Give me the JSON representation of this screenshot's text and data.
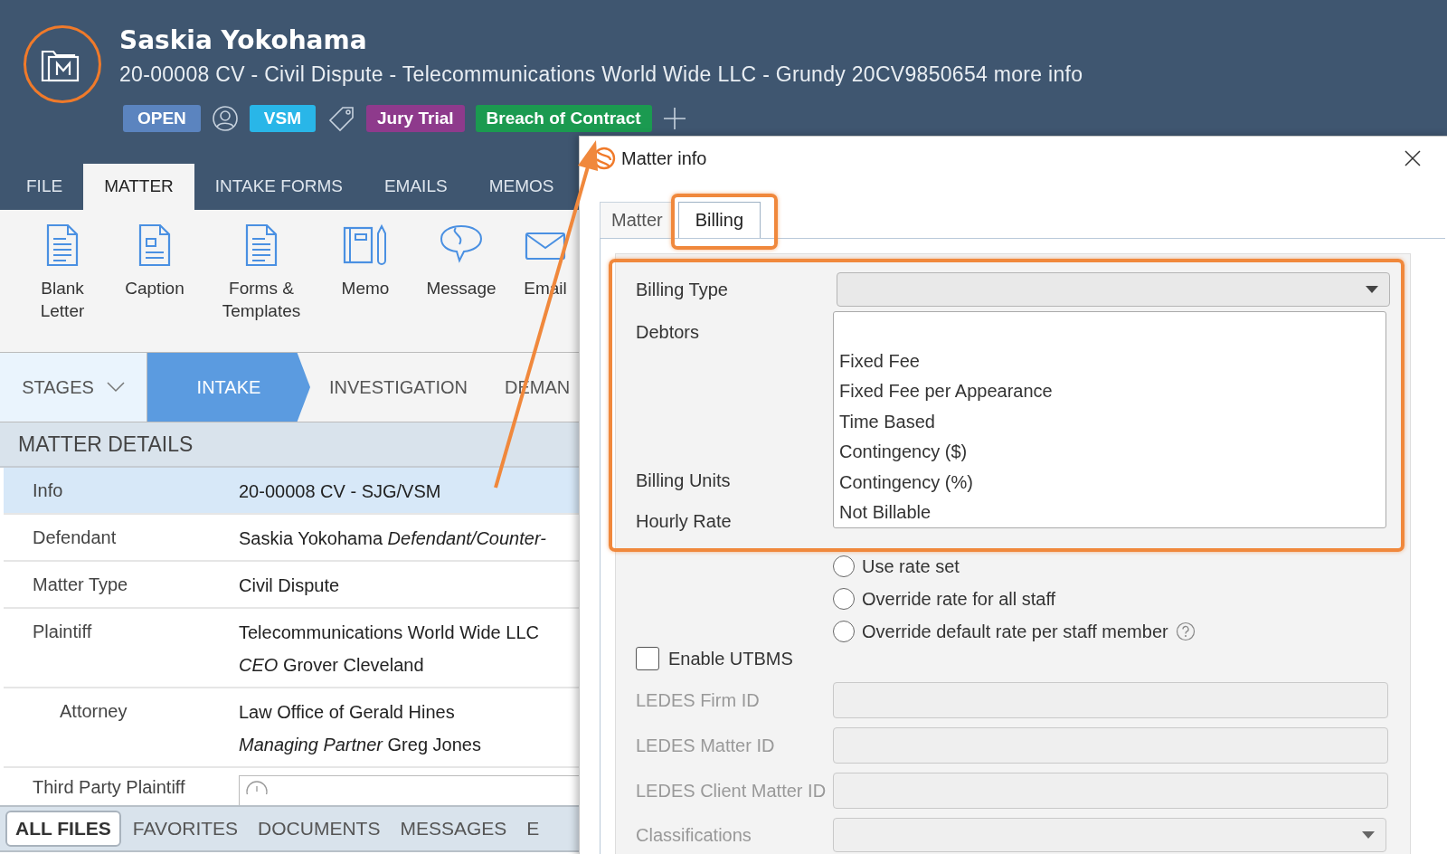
{
  "header": {
    "title": "Saskia Yokohama",
    "subtitle": "20-00008 CV - Civil Dispute - Telecommunications World Wide LLC - Grundy 20CV9850654 more info",
    "status": "OPEN",
    "assignee": "VSM",
    "tags": [
      {
        "label": "Jury Trial",
        "color": "#8e3a8c"
      },
      {
        "label": "Breach of Contract",
        "color": "#1b9a50"
      }
    ]
  },
  "ribbon_tabs": [
    {
      "label": "FILE",
      "selected": false
    },
    {
      "label": "MATTER",
      "selected": true
    },
    {
      "label": "INTAKE FORMS",
      "selected": false
    },
    {
      "label": "EMAILS",
      "selected": false
    },
    {
      "label": "MEMOS",
      "selected": false
    }
  ],
  "ribbon_actions": [
    {
      "label": "Blank Letter",
      "kind": "letter"
    },
    {
      "label": "Caption",
      "kind": "caption"
    },
    {
      "label": "Forms & Templates",
      "kind": "forms"
    },
    {
      "label": "Memo",
      "kind": "memo"
    },
    {
      "label": "Message",
      "kind": "message"
    },
    {
      "label": "Email",
      "kind": "email"
    }
  ],
  "stages": {
    "label": "STAGES",
    "steps": [
      {
        "label": "INTAKE",
        "selected": true
      },
      {
        "label": "INVESTIGATION",
        "selected": false
      },
      {
        "label": "DEMAN",
        "selected": false
      }
    ]
  },
  "matter_details": {
    "title": "MATTER DETAILS",
    "rows": [
      {
        "label": "Info",
        "lines": [
          "20-00008 CV - SJG/VSM"
        ],
        "selected": true
      },
      {
        "label": "Defendant",
        "lines": [
          "Saskia Yokohama *Defendant/Counter-*"
        ],
        "selected": false
      },
      {
        "label": "Matter Type",
        "lines": [
          "Civil Dispute"
        ],
        "selected": false
      },
      {
        "label": "Plaintiff",
        "lines": [
          "Telecommunications World Wide LLC",
          "*CEO* Grover Cleveland"
        ],
        "selected": false,
        "children": [
          {
            "label": "Attorney",
            "lines": [
              "Law Office of Gerald Hines",
              "*Managing Partner* Greg Jones"
            ],
            "selected": false
          }
        ]
      },
      {
        "label": "Third Party Plaintiff",
        "kind": "field",
        "selected": false
      }
    ]
  },
  "file_tabs": [
    {
      "label": "ALL FILES",
      "selected": true
    },
    {
      "label": "FAVORITES",
      "selected": false
    },
    {
      "label": "DOCUMENTS",
      "selected": false
    },
    {
      "label": "MESSAGES",
      "selected": false
    },
    {
      "label": "E",
      "selected": false
    }
  ],
  "dialog": {
    "title": "Matter info",
    "tabs": [
      {
        "label": "Matter",
        "selected": false
      },
      {
        "label": "Billing",
        "selected": true
      }
    ],
    "billing_type": {
      "label": "Billing Type",
      "expanded": true,
      "options": [
        "Fixed Fee",
        "Fixed Fee per Appearance",
        "Time Based",
        "Contingency ($)",
        "Contingency (%)",
        "Not Billable"
      ]
    },
    "debtors_label": "Debtors",
    "billing_units_label": "Billing Units",
    "hourly_rate": {
      "label": "Hourly Rate",
      "options": [
        {
          "label": "Use rate set",
          "selected": false,
          "help": false
        },
        {
          "label": "Override rate for all staff",
          "selected": false,
          "help": false
        },
        {
          "label": "Override default rate per staff member",
          "selected": false,
          "help": true
        }
      ]
    },
    "enable_utbms": {
      "label": "Enable UTBMS",
      "checked": false
    },
    "ledes_fields": [
      {
        "label": "LEDES Firm ID",
        "disabled": true
      },
      {
        "label": "LEDES Matter ID",
        "disabled": true
      },
      {
        "label": "LEDES Client Matter ID",
        "disabled": true
      }
    ],
    "classifications": {
      "label": "Classifications",
      "disabled": true
    }
  }
}
